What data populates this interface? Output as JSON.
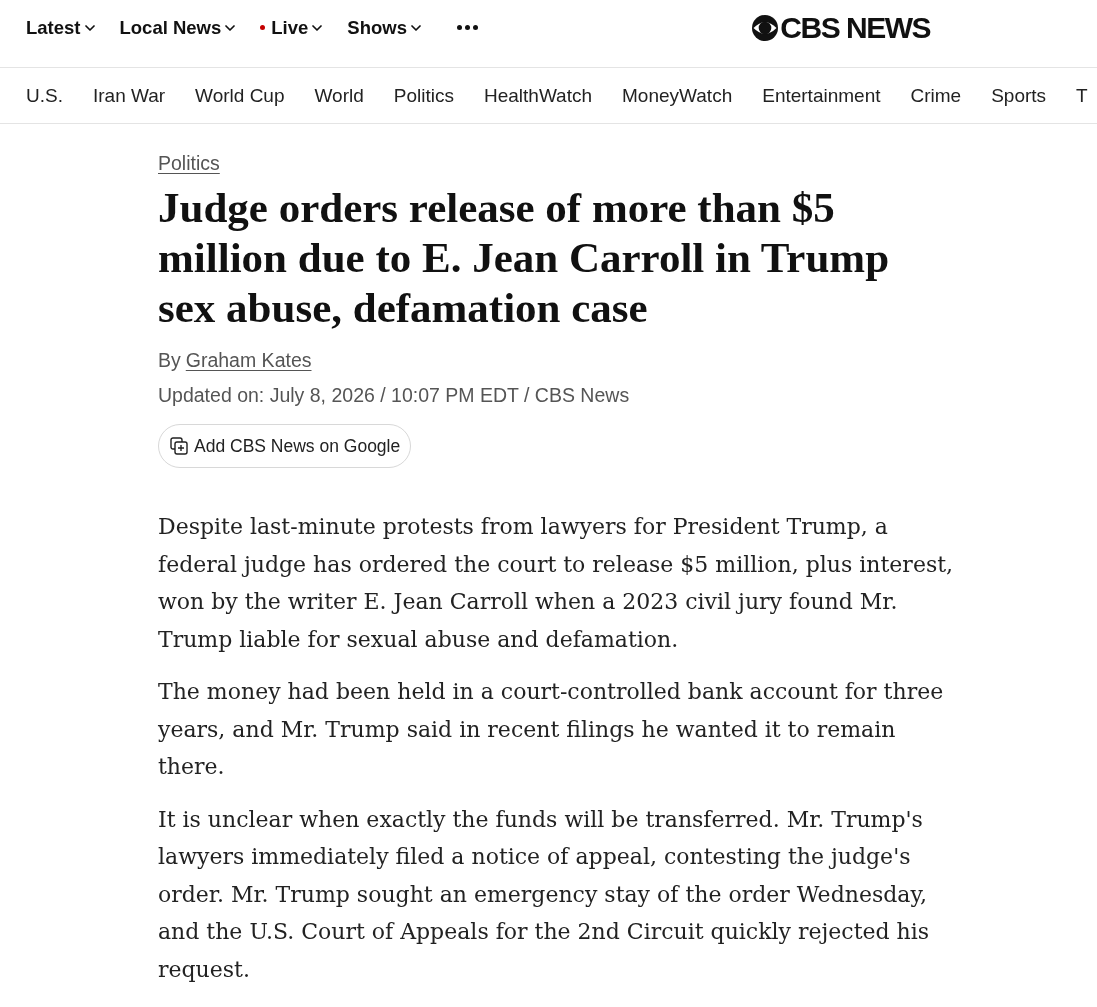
{
  "top_nav": {
    "items": [
      {
        "label": "Latest",
        "live": false,
        "dropdown": true
      },
      {
        "label": "Local News",
        "live": false,
        "dropdown": true
      },
      {
        "label": "Live",
        "live": true,
        "dropdown": true
      },
      {
        "label": "Shows",
        "live": false,
        "dropdown": true
      }
    ]
  },
  "logo": {
    "text": "CBS NEWS"
  },
  "section_nav": {
    "items": [
      "U.S.",
      "Iran War",
      "World Cup",
      "World",
      "Politics",
      "HealthWatch",
      "MoneyWatch",
      "Entertainment",
      "Crime",
      "Sports",
      "T"
    ]
  },
  "article": {
    "category": "Politics",
    "headline": "Judge orders release of more than $5 million due to E. Jean Carroll in Trump sex abuse, defamation case",
    "byline": {
      "prefix": "By",
      "author": "Graham Kates"
    },
    "updated": "Updated on: July 8, 2026 / 10:07 PM EDT / CBS News",
    "source_button": "Add CBS News on Google",
    "paragraphs": [
      "Despite last-minute protests from lawyers for President Trump, a federal judge has ordered the court to release $5 million, plus interest, won by the writer E. Jean Carroll when a 2023 civil jury found Mr. Trump liable for sexual abuse and defamation.",
      "The money had been held in a court-controlled bank account for three years, and Mr. Trump said in recent filings he wanted it to remain there.",
      "It is unclear when exactly the funds will be transferred. Mr. Trump's lawyers immediately filed a notice of appeal, contesting the judge's order. Mr. Trump sought an emergency stay of the order Wednesday, and the U.S. Court of Appeals for the 2nd Circuit quickly rejected his request."
    ]
  }
}
